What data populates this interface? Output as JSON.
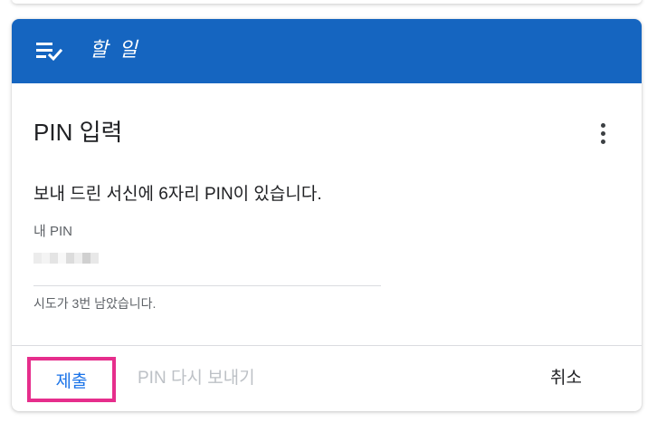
{
  "header": {
    "title": "할 일",
    "icon": "task-list-check-icon",
    "background_color": "#1565c0"
  },
  "card": {
    "title": "PIN 입력",
    "menu_icon": "more-vertical-icon",
    "instruction": "보내 드린 서신에 6자리 PIN이 있습니다.",
    "pin_field": {
      "label": "내 PIN",
      "value_obscured": true
    },
    "attempts_text": "시도가 3번 남았습니다."
  },
  "actions": {
    "submit_label": "제출",
    "resend_label": "PIN 다시 보내기",
    "cancel_label": "취소",
    "accent_color": "#1a73e8",
    "highlight_color": "#e62e8c"
  }
}
